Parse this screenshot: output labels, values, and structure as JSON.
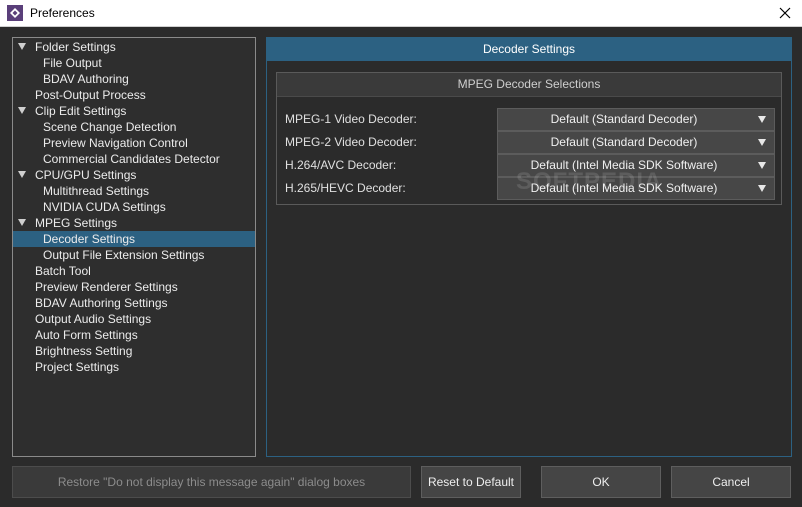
{
  "window": {
    "title": "Preferences",
    "app_icon": "app-logo-icon",
    "close_icon": "close-icon"
  },
  "tree": {
    "items": [
      {
        "label": "Folder Settings",
        "level": 0,
        "expanded": true
      },
      {
        "label": "File Output",
        "level": 1
      },
      {
        "label": "BDAV Authoring",
        "level": 1
      },
      {
        "label": "Post-Output Process",
        "level": 0
      },
      {
        "label": "Clip Edit Settings",
        "level": 0,
        "expanded": true
      },
      {
        "label": "Scene Change Detection",
        "level": 1
      },
      {
        "label": "Preview Navigation Control",
        "level": 1
      },
      {
        "label": "Commercial Candidates Detector",
        "level": 1
      },
      {
        "label": "CPU/GPU Settings",
        "level": 0,
        "expanded": true
      },
      {
        "label": "Multithread Settings",
        "level": 1
      },
      {
        "label": "NVIDIA CUDA Settings",
        "level": 1
      },
      {
        "label": "MPEG Settings",
        "level": 0,
        "expanded": true
      },
      {
        "label": "Decoder Settings",
        "level": 1,
        "selected": true
      },
      {
        "label": "Output File Extension Settings",
        "level": 1
      },
      {
        "label": "Batch Tool",
        "level": 0
      },
      {
        "label": "Preview Renderer Settings",
        "level": 0
      },
      {
        "label": "BDAV Authoring Settings",
        "level": 0
      },
      {
        "label": "Output Audio Settings",
        "level": 0
      },
      {
        "label": "Auto Form Settings",
        "level": 0
      },
      {
        "label": "Brightness Setting",
        "level": 0
      },
      {
        "label": "Project Settings",
        "level": 0
      }
    ]
  },
  "pane": {
    "title": "Decoder Settings",
    "group_title": "MPEG Decoder Selections",
    "decoders": [
      {
        "label": "MPEG-1 Video Decoder:",
        "value": "Default (Standard Decoder)"
      },
      {
        "label": "MPEG-2 Video Decoder:",
        "value": "Default (Standard Decoder)"
      },
      {
        "label": "H.264/AVC Decoder:",
        "value": "Default (Intel Media SDK Software)"
      },
      {
        "label": "H.265/HEVC Decoder:",
        "value": "Default (Intel Media SDK Software)"
      }
    ]
  },
  "buttons": {
    "restore": "Restore \"Do not display this message again\" dialog boxes",
    "reset": "Reset to Default",
    "ok": "OK",
    "cancel": "Cancel"
  },
  "watermark": "SOFTPEDIA",
  "colors": {
    "background": "#2b2b2b",
    "accent": "#2c6182",
    "combo": "#474747"
  }
}
